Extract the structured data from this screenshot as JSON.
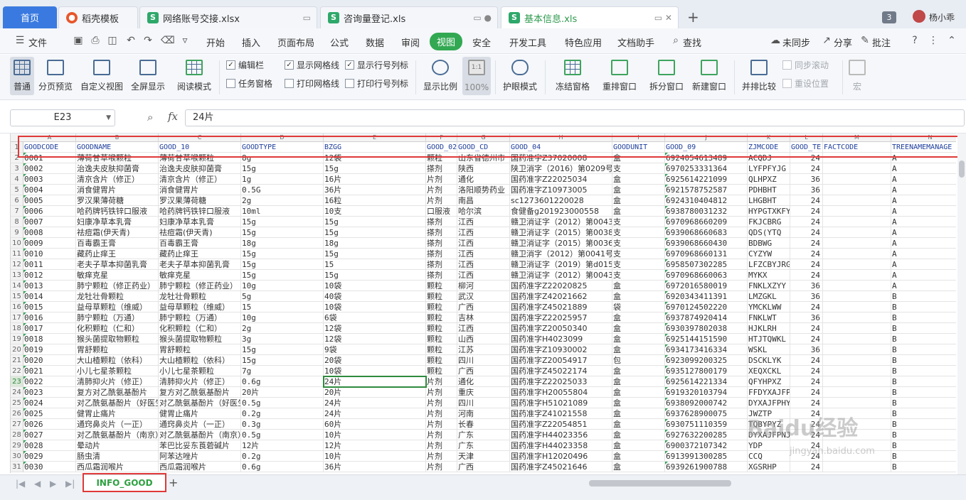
{
  "tabs": [
    {
      "label": "首页",
      "icon": "home"
    },
    {
      "label": "稻壳模板",
      "icon": "docer-icon"
    },
    {
      "label": "网络账号交接.xlsx",
      "icon": "sheet-icon"
    },
    {
      "label": "咨询量登记.xls",
      "icon": "sheet-icon"
    },
    {
      "label": "基本信息.xls",
      "icon": "sheet-icon",
      "active": true
    }
  ],
  "tab_count": "3",
  "username": "杨小乖",
  "menu": {
    "file": "文件",
    "items": [
      "开始",
      "插入",
      "页面布局",
      "公式",
      "数据",
      "审阅",
      "视图",
      "安全",
      "开发工具",
      "特色应用",
      "文档助手"
    ],
    "active": "视图",
    "search": "查找",
    "sync": "未同步",
    "share": "分享",
    "comment": "批注"
  },
  "ribbon": {
    "normal": "普通",
    "page_break": "分页预览",
    "custom_view": "自定义视图",
    "fullscreen": "全屏显示",
    "reading_mode": "阅读模式",
    "edit_bar": "编辑栏",
    "task_pane": "任务窗格",
    "show_gridlines": "显示网格线",
    "print_gridlines": "打印网格线",
    "show_headers": "显示行号列标",
    "print_headers": "打印行号列标",
    "zoom_ratio": "显示比例",
    "zoom_100": "100%",
    "eye_mode": "护眼模式",
    "freeze": "冻结窗格",
    "arrange": "重排窗口",
    "split": "拆分窗口",
    "new_window": "新建窗口",
    "side_by_side": "并排比较",
    "sync_scroll": "同步滚动",
    "reset_position": "重设位置",
    "macro": "宏"
  },
  "formula_bar": {
    "cell_ref": "E23",
    "fx": "fx",
    "value": "24片"
  },
  "columns": [
    "A",
    "B",
    "C",
    "D",
    "E",
    "F",
    "G",
    "H",
    "I",
    "J",
    "K",
    "L",
    "M",
    "N"
  ],
  "header_row": [
    "GOODCODE",
    "GOODNAME",
    "GOOD_10",
    "GOODTYPE",
    "BZGG",
    "GOOD_02",
    "GOOD_CD",
    "GOOD_04",
    "GOODUNIT",
    "GOOD_09",
    "ZJMCODE",
    "GOOD_TE",
    "FACTCODE",
    "TREENAMEMANAGE"
  ],
  "rows": [
    [
      "0001",
      "薄荷甘草喉颗粒",
      "薄荷甘草喉颗粒",
      "8g",
      "12袋",
      "颗粒",
      "山东省德州市",
      "国药准字Z37020008",
      "盒",
      "6924054613489",
      "ACQDJ",
      "24",
      "",
      "A"
    ],
    [
      "0002",
      "治逸夫皮肤抑菌膏",
      "治逸夫皮肤抑菌膏",
      "15g",
      "15g",
      "搽剂",
      "陕西",
      "陕卫消字（2016）第0209号",
      "支",
      "6970253331364",
      "LYFPFYJG",
      "24",
      "",
      "A"
    ],
    [
      "0003",
      "清京含片（修正）",
      "清京含片（修正）",
      "1g",
      "16片",
      "片剂",
      "通化",
      "国药准字Z22025034",
      "盒",
      "6925614221099",
      "QLHPXZ",
      "36",
      "",
      "A"
    ],
    [
      "0004",
      "消食健胃片",
      "消食健胃片",
      "0.5G",
      "36片",
      "片剂",
      "洛阳顺势药业",
      "国药准字Z10973005",
      "盒",
      "6921578752587",
      "PDHBHT",
      "36",
      "",
      "A"
    ],
    [
      "0005",
      "罗汉果薄荷糖",
      "罗汉果薄荷糖",
      "2g",
      "16粒",
      "片剂",
      "南昌",
      "sc1273601220028",
      "盒",
      "6924310404812",
      "LHGBHT",
      "24",
      "",
      "A"
    ],
    [
      "0006",
      "哈药牌钙铁锌口服液",
      "哈药牌钙铁锌口服液",
      "10ml",
      "10支",
      "口服液",
      "哈尔滨",
      "食健备g201923000558",
      "盒",
      "6938780031232",
      "HYPGTXKFY",
      "24",
      "",
      "A"
    ],
    [
      "0007",
      "妇康净草本乳膏",
      "妇康净草本乳膏",
      "15g",
      "15g",
      "搽剂",
      "江西",
      "赣卫消证字（2012）第0043号",
      "支",
      "6970968660209",
      "FKJCBRG",
      "24",
      "",
      "A"
    ],
    [
      "0008",
      "祛痘霜(伊天青)",
      "祛痘霜(伊天青)",
      "15g",
      "15g",
      "搽剂",
      "江西",
      "赣卫消证字（2015）第0038号",
      "支",
      "6939068660683",
      "QDS(YTQ",
      "24",
      "",
      "A"
    ],
    [
      "0009",
      "百毒霸王膏",
      "百毒霸王膏",
      "18g",
      "18g",
      "搽剂",
      "江西",
      "赣卫消证字（2015）第0036号",
      "支",
      "6939068660430",
      "BDBWG",
      "24",
      "",
      "A"
    ],
    [
      "0010",
      "藏药止痒王",
      "藏药止痒王",
      "15g",
      "15g",
      "搽剂",
      "江西",
      "赣卫消字（2012）第0041号",
      "支",
      "6970968660131",
      "CYZYW",
      "24",
      "",
      "A"
    ],
    [
      "0011",
      "老夫子草本抑菌乳膏",
      "老夫子草本抑菌乳膏",
      "15g",
      "15",
      "搽剂",
      "江西",
      "赣卫消证字（2019）第d015号",
      "支",
      "6958507302285",
      "LFZCBYJRG",
      "24",
      "",
      "A"
    ],
    [
      "0012",
      "敏痒克星",
      "敏痒克星",
      "15g",
      "15g",
      "搽剂",
      "江西",
      "赣卫消证字（2012）第0043号",
      "支",
      "6970968660063",
      "MYKX",
      "24",
      "",
      "A"
    ],
    [
      "0013",
      "肺宁颗粒（修正药业）",
      "肺宁颗粒（修正药业）",
      "10g",
      "10袋",
      "颗粒",
      "柳河",
      "国药准字Z22020825",
      "盒",
      "6972016580019",
      "FNKLXZYY",
      "36",
      "",
      "A"
    ],
    [
      "0014",
      "龙牡壮骨颗粒",
      "龙牡壮骨颗粒",
      "5g",
      "40袋",
      "颗粒",
      "武汉",
      "国药准字Z42021662",
      "盒",
      "6920343411391",
      "LMZGKL",
      "36",
      "",
      "B"
    ],
    [
      "0015",
      "益母草颗粒（维威）",
      "益母草颗粒（维威）",
      "15",
      "10袋",
      "颗粒",
      "广西",
      "国药准字Z45021889",
      "袋",
      "6970124502220",
      "YMCKLWW",
      "24",
      "",
      "B"
    ],
    [
      "0016",
      "肺宁颗粒（万通）",
      "肺宁颗粒（万通）",
      "10g",
      "6袋",
      "颗粒",
      "吉林",
      "国药准字Z22025957",
      "盒",
      "6937874920414",
      "FNKLWT",
      "36",
      "",
      "B"
    ],
    [
      "0017",
      "化积颗粒（仁和）",
      "化积颗粒（仁和）",
      "2g",
      "12袋",
      "颗粒",
      "江西",
      "国药准字Z20050340",
      "盒",
      "6930397802038",
      "HJKLRH",
      "24",
      "",
      "B"
    ],
    [
      "0018",
      "猴头菌提取物颗粒",
      "猴头菌提取物颗粒",
      "3g",
      "12袋",
      "颗粒",
      "山西",
      "国药准字H4023099",
      "盒",
      "6925144151590",
      "HTJTQWKL",
      "24",
      "",
      "B"
    ],
    [
      "0019",
      "胃舒颗粒",
      "胃舒颗粒",
      "15g",
      "9袋",
      "颗粒",
      "江苏",
      "国药准字Z10930002",
      "盒",
      "6934173416334",
      "WSKL",
      "36",
      "",
      "B"
    ],
    [
      "0020",
      "大山楂颗粒（依科）",
      "大山楂颗粒（依科）",
      "15g",
      "20袋",
      "颗粒",
      "四川",
      "国药准字Z20054917",
      "包",
      "6923099200325",
      "DSCKLYK",
      "24",
      "",
      "B"
    ],
    [
      "0021",
      "小儿七星茶颗粒",
      "小儿七星茶颗粒",
      "7g",
      "10袋",
      "颗粒",
      "广西",
      "国药准字Z45022174",
      "盒",
      "6935127800179",
      "XEQXCKL",
      "24",
      "",
      "B"
    ],
    [
      "0022",
      "清肺抑火片（修正）",
      "清肺抑火片（修正）",
      "0.6g",
      "24片",
      "片剂",
      "通化",
      "国药准字Z22025033",
      "盒",
      "6925614221334",
      "QFYHPXZ",
      "24",
      "",
      "B"
    ],
    [
      "0023",
      "复方对乙酰氨基酚片",
      "复方对乙酰氨基酚片",
      "20片",
      "20片",
      "片剂",
      "重庆",
      "国药准字H20055804",
      "盒",
      "6919320103794",
      "FFDYXAJFPX",
      "24",
      "",
      "B"
    ],
    [
      "0024",
      "对乙酰氨基酚片（好医生）",
      "对乙酰氨基酚片（好医生）",
      "0.5g",
      "24片",
      "片剂",
      "四川",
      "国药准字H51021089",
      "盒",
      "6938092000742",
      "DYXAJFPHYS",
      "24",
      "",
      "B"
    ],
    [
      "0025",
      "健胃止痛片",
      "健胃止痛片",
      "0.2g",
      "24片",
      "片剂",
      "河南",
      "国药准字Z41021558",
      "盒",
      "6937628900075",
      "JWZTP",
      "24",
      "",
      "B"
    ],
    [
      "0026",
      "通窍鼻炎片（一正）",
      "通窍鼻炎片（一正）",
      "0.3g",
      "60片",
      "片剂",
      "长春",
      "国药准字Z22054851",
      "盒",
      "6930751110359",
      "TQBYPYZ",
      "24",
      "",
      "B"
    ],
    [
      "0027",
      "对乙酰氨基酚片（南京）",
      "对乙酰氨基酚片（南京）",
      "0.5g",
      "10片",
      "片剂",
      "广东",
      "国药准字H44023356",
      "盒",
      "6927632200285",
      "DYXAJFPNJ",
      "24",
      "",
      "B"
    ],
    [
      "0028",
      "晕动片",
      "苯巴比妥东莨菪碱片",
      "12片",
      "12片",
      "片剂",
      "广东",
      "国药准字H44023358",
      "盒",
      "6900372107342",
      "YDP",
      "24",
      "",
      "B"
    ],
    [
      "0029",
      "肠虫清",
      "阿苯达唑片",
      "0.2g",
      "10片",
      "片剂",
      "天津",
      "国药准字H12020496",
      "盒",
      "6913991300285",
      "CCQ",
      "24",
      "",
      "B"
    ],
    [
      "0030",
      "西瓜霜润喉片",
      "西瓜霜润喉片",
      "0.6g",
      "36片",
      "片剂",
      "广西",
      "国药准字Z45021646",
      "盒",
      "6939261900788",
      "XGSRHP",
      "24",
      "",
      "B"
    ]
  ],
  "sheet_tab": "INFO_GOOD",
  "watermark": "Baidu经验",
  "watermark_url": "jingyan.baidu.com"
}
